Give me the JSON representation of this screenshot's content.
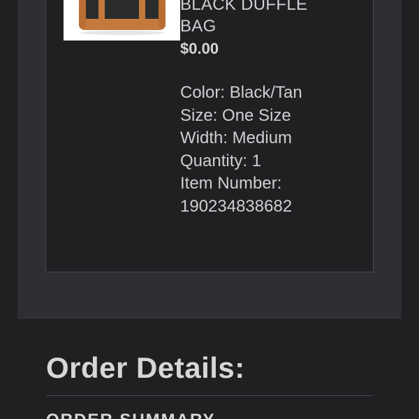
{
  "item": {
    "name_line1": "BLACK DUFFLE",
    "name_line2": "BAG",
    "price": "$0.00",
    "image_icon": "duffle-bag-image",
    "attributes": [
      "Color: Black/Tan",
      "Size: One Size",
      "Width: Medium",
      "Quantity: 1",
      "Item Number:",
      "190234838682"
    ]
  },
  "order_details": {
    "heading": "Order Details:",
    "summary_heading": "ORDER SUMMARY"
  },
  "colors": {
    "background": "#202023",
    "panel": "#2f2f33",
    "text": "#cfcfd2",
    "bag_body": "#2a2c2b",
    "bag_trim": "#c57a3d"
  }
}
